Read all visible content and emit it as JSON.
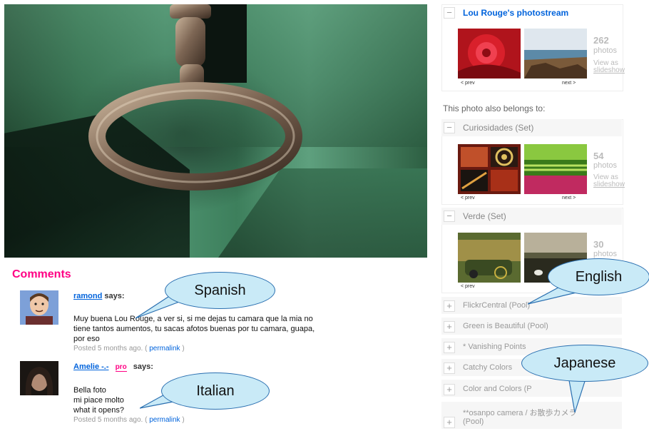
{
  "comments": {
    "title": "Comments",
    "items": [
      {
        "author": "ramond",
        "says": "says:",
        "lines": [
          "Muy buena Lou Rouge, a ver si, si me dejas tu camara que la mia no",
          "tiene tantos aumentos, tu sacas afotos buenas por tu camara, guapa,",
          "por eso"
        ],
        "posted": "Posted 5 months ago.",
        "permalink": "permalink"
      },
      {
        "author": "Amelie -.-",
        "pro": "pro",
        "says": "says:",
        "lines": [
          "Bella foto",
          "mi piace molto",
          "what it opens?"
        ],
        "posted": "Posted 5 months ago.",
        "permalink": "permalink"
      }
    ]
  },
  "sidebar": {
    "photostream": {
      "title": "Lou Rouge's photostream",
      "count": "262",
      "count_label": "photos",
      "view_as": "View as",
      "slideshow": "slideshow",
      "prev": "< prev",
      "next": "next >"
    },
    "belongs_label": "This photo also belongs to:",
    "sets": [
      {
        "title": "Curiosidades (Set)",
        "count": "54",
        "count_label": "photos",
        "view_as": "View as",
        "slideshow": "slideshow",
        "prev": "< prev",
        "next": "next >"
      },
      {
        "title": "Verde (Set)",
        "count": "30",
        "count_label": "photos",
        "prev": "< prev"
      }
    ],
    "pools": [
      "FlickrCentral (Pool)",
      "Green is Beautiful (Pool)",
      "* Vanishing Points",
      "Catchy Colors",
      "Color and Colors (P",
      "**osanpo camera / お散歩カメラ",
      "(Pool)"
    ],
    "minus_glyph": "−",
    "plus_glyph": "+"
  },
  "callouts": {
    "spanish": "Spanish",
    "italian": "Italian",
    "english": "English",
    "japanese": "Japanese"
  },
  "colors": {
    "comments_title": "#ff0084",
    "link": "#0063dc",
    "callout_fill": "#c9eaf7",
    "callout_border": "#2a6fb0"
  }
}
